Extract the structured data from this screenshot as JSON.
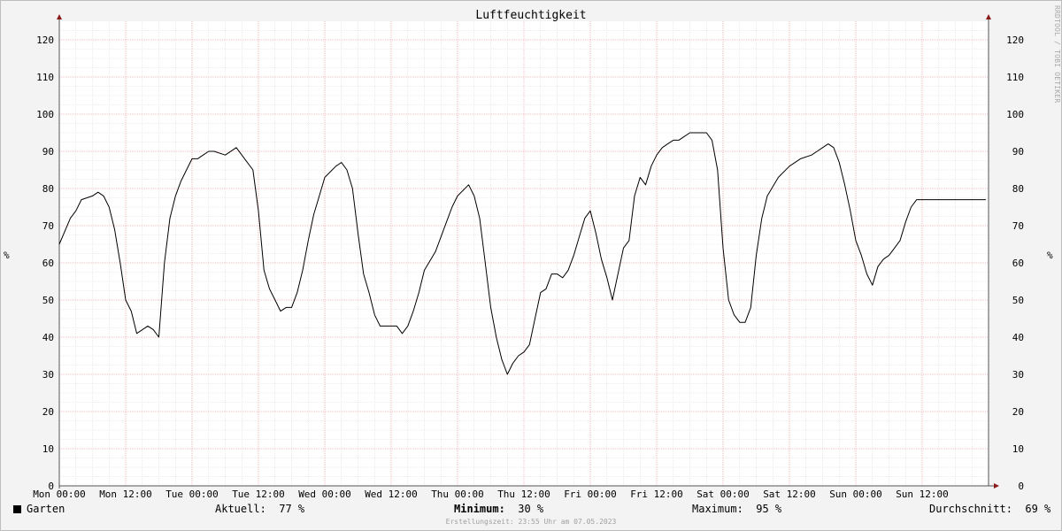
{
  "chart_data": {
    "type": "line",
    "title": "Luftfeuchtigkeit",
    "ylabel": "%",
    "ylim": [
      0,
      125
    ],
    "yticks": [
      0,
      10,
      20,
      30,
      40,
      50,
      60,
      70,
      80,
      90,
      100,
      110,
      120
    ],
    "xticks": [
      "Mon 00:00",
      "Mon 12:00",
      "Tue 00:00",
      "Tue 12:00",
      "Wed 00:00",
      "Wed 12:00",
      "Thu 00:00",
      "Thu 12:00",
      "Fri 00:00",
      "Fri 12:00",
      "Sat 00:00",
      "Sat 12:00",
      "Sun 00:00",
      "Sun 12:00"
    ],
    "grid": true,
    "series": [
      {
        "name": "Garten",
        "color": "#000000",
        "x_hours": [
          0,
          2,
          3,
          4,
          6,
          7,
          8,
          9,
          10,
          11,
          12,
          13,
          14,
          15,
          16,
          17,
          18,
          19,
          20,
          21,
          22,
          24,
          25,
          26,
          27,
          28,
          30,
          32,
          34,
          35,
          36,
          37,
          38,
          39,
          40,
          41,
          42,
          43,
          44,
          45,
          46,
          47,
          48,
          50,
          51,
          52,
          53,
          54,
          55,
          56,
          57,
          58,
          59,
          60,
          61,
          62,
          63,
          64,
          65,
          66,
          68,
          69,
          70,
          71,
          72,
          74,
          75,
          76,
          77,
          78,
          79,
          80,
          81,
          82,
          83,
          84,
          85,
          86,
          87,
          88,
          89,
          90,
          91,
          92,
          93,
          94,
          95,
          96,
          97,
          98,
          99,
          100,
          102,
          103,
          104,
          105,
          106,
          107,
          108,
          109,
          110,
          111,
          112,
          113,
          114,
          115,
          116,
          117,
          118,
          119,
          120,
          121,
          122,
          123,
          124,
          125,
          126,
          127,
          128,
          130,
          132,
          134,
          136,
          137,
          138,
          139,
          140,
          141,
          142,
          143,
          144,
          145,
          146,
          147,
          148,
          149,
          150,
          151,
          152,
          153,
          154,
          155,
          156,
          157,
          158,
          159,
          160,
          161,
          162,
          163,
          164,
          165,
          166,
          167.5
        ],
        "values": [
          65,
          72,
          74,
          77,
          78,
          79,
          78,
          75,
          69,
          60,
          50,
          47,
          41,
          42,
          43,
          42,
          40,
          60,
          72,
          78,
          82,
          88,
          88,
          89,
          90,
          90,
          89,
          91,
          87,
          85,
          74,
          58,
          53,
          50,
          47,
          48,
          48,
          52,
          58,
          66,
          73,
          78,
          83,
          86,
          87,
          85,
          80,
          68,
          57,
          52,
          46,
          43,
          43,
          43,
          43,
          41,
          43,
          47,
          52,
          58,
          63,
          67,
          71,
          75,
          78,
          81,
          78,
          72,
          60,
          48,
          40,
          34,
          30,
          33,
          35,
          36,
          38,
          45,
          52,
          53,
          57,
          57,
          56,
          58,
          62,
          67,
          72,
          74,
          68,
          61,
          56,
          50,
          64,
          66,
          78,
          83,
          81,
          86,
          89,
          91,
          92,
          93,
          93,
          94,
          95,
          95,
          95,
          95,
          93,
          85,
          64,
          50,
          46,
          44,
          44,
          48,
          62,
          72,
          78,
          83,
          86,
          88,
          89,
          90,
          91,
          92,
          91,
          87,
          81,
          74,
          66,
          62,
          57,
          54,
          59,
          61,
          62,
          64,
          66,
          71,
          75,
          77,
          77,
          77,
          77,
          77,
          77,
          77,
          77,
          77,
          77,
          77,
          77,
          77
        ]
      }
    ],
    "legend_position": "bottom-left"
  },
  "legend": {
    "series_name": "Garten",
    "current_label": "Aktuell:",
    "current_value": "77 %",
    "min_label": "Minimum:",
    "min_value": "30 %",
    "max_label": "Maximum:",
    "max_value": "95 %",
    "avg_label": "Durchschnitt:",
    "avg_value": "69 %"
  },
  "watermark": "RRDTOOL / TOBI OETIKER",
  "footer": "Erstellungszeit: 23:55 Uhr am 07.05.2023",
  "colors": {
    "background": "#f3f3f3",
    "canvas": "#ffffff",
    "minor_grid": "#dddddd",
    "major_grid": "#f2aaaa",
    "axis": "#8b1a1a",
    "line": "#000000"
  }
}
